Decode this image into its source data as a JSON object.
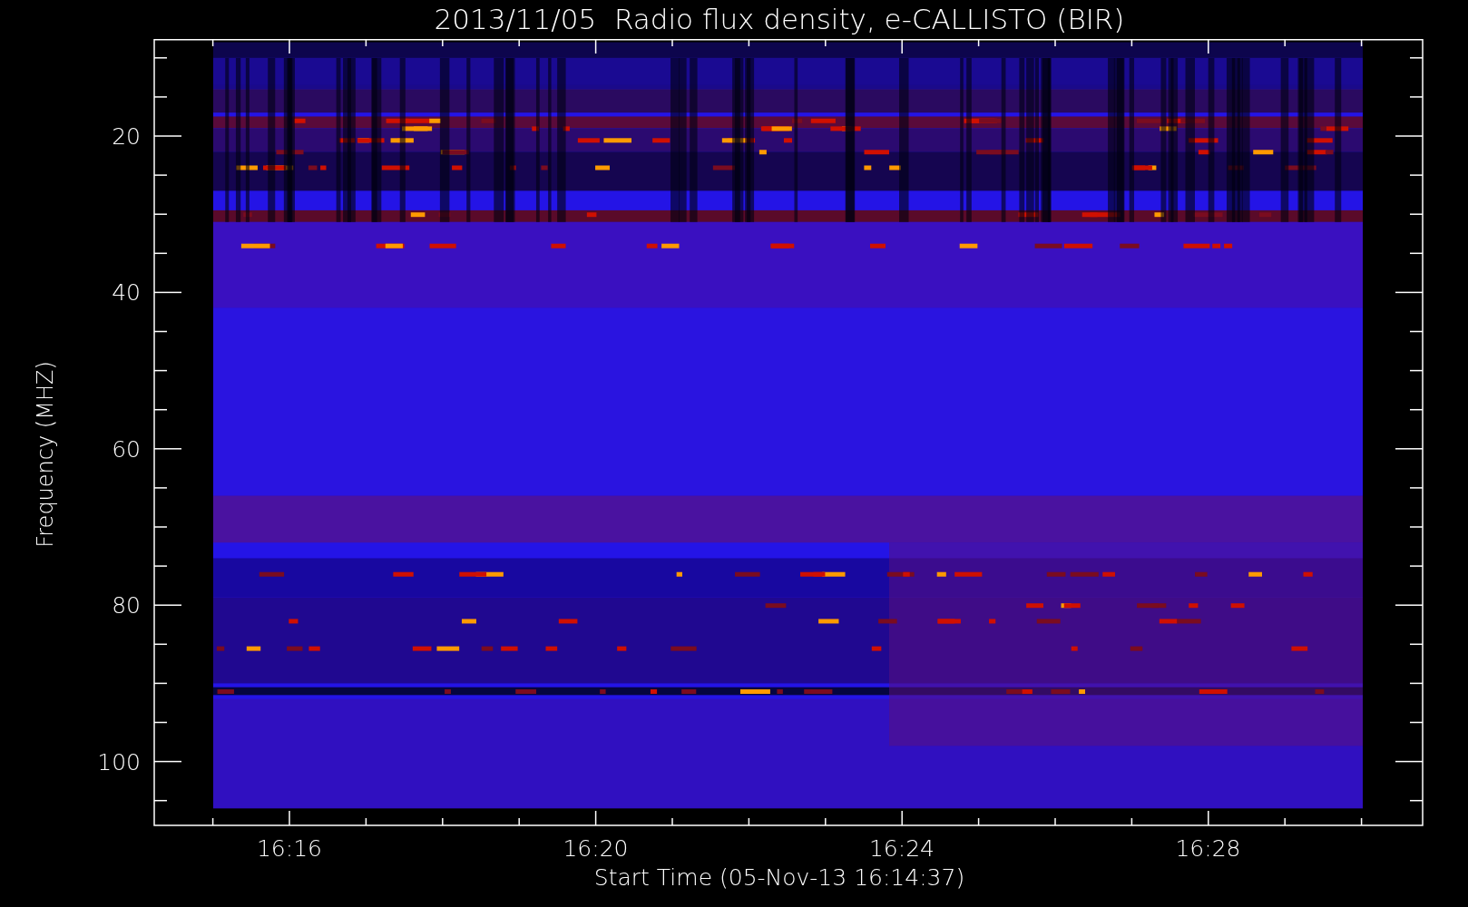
{
  "title": "2013/11/05  Radio flux density, e-CALLISTO (BIR)",
  "y_axis": {
    "label": "Frequency (MHZ)",
    "ticks": [
      "20",
      "40",
      "60",
      "80",
      "100"
    ]
  },
  "x_axis": {
    "label": "Start Time (05-Nov-13 16:14:37)",
    "ticks": [
      "16:16",
      "16:20",
      "16:24",
      "16:28"
    ]
  }
}
